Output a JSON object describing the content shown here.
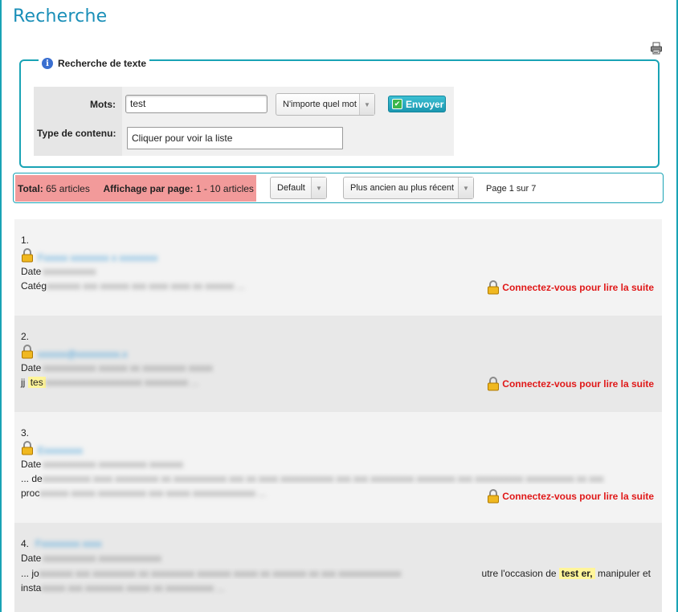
{
  "page": {
    "title": "Recherche"
  },
  "icons": {
    "print": "printer-icon",
    "info": "info-icon",
    "lock": "lock-icon",
    "check": "checkmark-icon",
    "dropdown": "chevron-down-icon"
  },
  "colors": {
    "accent": "#19a3b5",
    "title": "#1a8fb8",
    "total_bg": "#f29a9a",
    "login": "#e01818",
    "link": "#3a9bd8",
    "highlight": "#fff59a"
  },
  "search_form": {
    "legend": "Recherche de texte",
    "info_glyph": "i",
    "mots_label": "Mots:",
    "mots_value": "test",
    "match_select": "N'importe quel mot",
    "submit_label": "Envoyer",
    "type_label": "Type de contenu:",
    "type_value": "Cliquer pour voir la liste"
  },
  "results_bar": {
    "total_label": "Total:",
    "total_value": "65 articles",
    "per_page_label": "Affichage par page:",
    "per_page_value": "1 - 10 articles",
    "sort_select": "Default",
    "order_select": "Plus ancien au plus récent",
    "page_info": "Page 1 sur 7"
  },
  "results": [
    {
      "num": "1.",
      "title": "Fxxxxx xxxxxxxx x xxxxxxxx",
      "line1_prefix": "Date",
      "line1_blur": "xxxxxxxxxxx",
      "line2_prefix": "Catég",
      "line2_blur": "xxxxxxx xxx xxxxxx xxx xxxx xxxx xx xxxxxx ...",
      "login": "Connectez-vous pour lire la suite"
    },
    {
      "num": "2.",
      "title": "xxxxxx@xxxxxxxxx.x",
      "line1_prefix": "Date",
      "line1_blur": "xxxxxxxxxxx xxxxxx xx xxxxxxxxx xxxxx",
      "line2_prefix": "jj",
      "line2_hl": "tes",
      "line2_blur": "xxxxxxxxxxxxxxxxxxxx xxxxxxxxx ...",
      "login": "Connectez-vous pour lire la suite"
    },
    {
      "num": "3.",
      "title": "Exxxxxxxx",
      "line1_prefix": "Date",
      "line1_blur": "xxxxxxxxxxx xxxxxxxxxx xxxxxxx",
      "line2_prefix": "... de",
      "line2_blur": "xxxxxxxxxx xxxx xxxxxxxxx xx xxxxxxxxxxx xxx xx xxxx xxxxxxxxxxx xxx xxx xxxxxxxxx xxxxxxxx xxx xxxxxxxxxx xxxxxxxxxx xx xxx",
      "line3_prefix": "proc",
      "line3_blur": "xxxxxx xxxxx xxxxxxxxxx xxx xxxxx xxxxxxxxxxxxx ...",
      "login": "Connectez-vous pour lire la suite"
    },
    {
      "num": "4.",
      "title": "Fxxxxxxxx xxxx",
      "line1_prefix": "Date",
      "line1_blur": "xxxxxxxxxxx xxxxxxxxxxxxx",
      "line2_prefix": "... jo",
      "line2_blur": "xxxxxxx xxx xxxxxxxxx xx xxxxxxxxx xxxxxxx xxxxx xx xxxxxxx xx xxx xxxxxxxxxxxxx",
      "line2_tail": "utre l'occasion de",
      "line2_hl": "test er,",
      "line2_end": "manipuler et",
      "line3_prefix": "insta",
      "line3_blur": "xxxxx xxx xxxxxxxx xxxxx xx xxxxxxxxxx ..."
    }
  ]
}
